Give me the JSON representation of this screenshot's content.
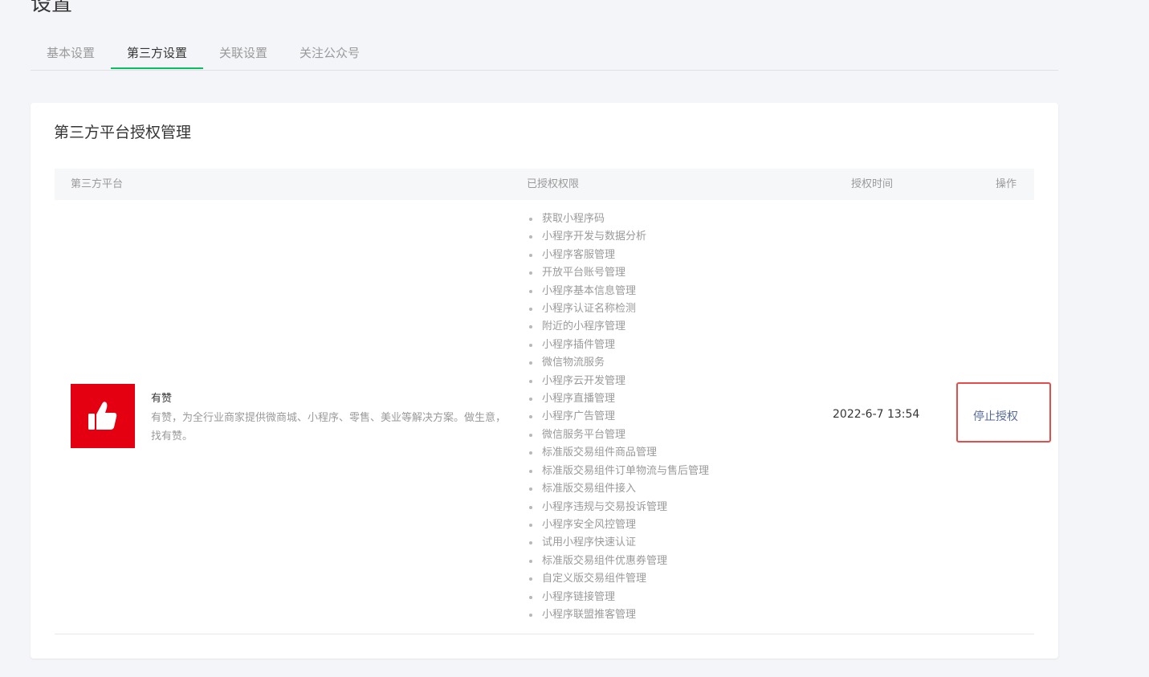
{
  "page": {
    "title": "设置"
  },
  "tabs": [
    {
      "label": "基本设置",
      "active": false
    },
    {
      "label": "第三方设置",
      "active": true
    },
    {
      "label": "关联设置",
      "active": false
    },
    {
      "label": "关注公众号",
      "active": false
    }
  ],
  "card": {
    "title": "第三方平台授权管理"
  },
  "table": {
    "headers": {
      "platform": "第三方平台",
      "permissions": "已授权权限",
      "time": "授权时间",
      "action": "操作"
    },
    "rows": [
      {
        "logo_icon": "thumbs-up-icon",
        "logo_color": "#e50011",
        "name": "有赞",
        "description": "有赞，为全行业商家提供微商城、小程序、零售、美业等解决方案。做生意，找有赞。",
        "permissions": [
          "获取小程序码",
          "小程序开发与数据分析",
          "小程序客服管理",
          "开放平台账号管理",
          "小程序基本信息管理",
          "小程序认证名称检测",
          "附近的小程序管理",
          "小程序插件管理",
          "微信物流服务",
          "小程序云开发管理",
          "小程序直播管理",
          "小程序广告管理",
          "微信服务平台管理",
          "标准版交易组件商品管理",
          "标准版交易组件订单物流与售后管理",
          "标准版交易组件接入",
          "小程序违规与交易投诉管理",
          "小程序安全风控管理",
          "试用小程序快速认证",
          "标准版交易组件优惠券管理",
          "自定义版交易组件管理",
          "小程序链接管理",
          "小程序联盟推客管理"
        ],
        "auth_time": "2022-6-7 13:54",
        "action_label": "停止授权"
      }
    ]
  },
  "colors": {
    "accent": "#07c160",
    "link": "#576b95",
    "highlight_box": "#e54c4c"
  }
}
